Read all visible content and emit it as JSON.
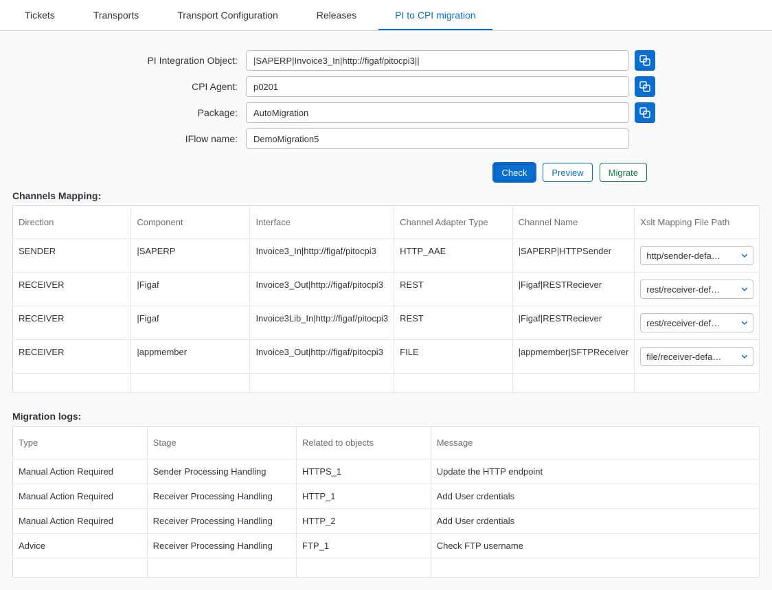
{
  "tabs": [
    "Tickets",
    "Transports",
    "Transport Configuration",
    "Releases",
    "PI to CPI migration"
  ],
  "active_tab_index": 4,
  "form": {
    "pi_object_label": "PI Integration Object:",
    "pi_object_value": "|SAPERP|Invoice3_In|http://figaf/pitocpi3||",
    "cpi_agent_label": "CPI Agent:",
    "cpi_agent_value": "p0201",
    "package_label": "Package:",
    "package_value": "AutoMigration",
    "iflow_label": "IFlow name:",
    "iflow_value": "DemoMigration5"
  },
  "buttons": {
    "check": "Check",
    "preview": "Preview",
    "migrate": "Migrate"
  },
  "channels_title": "Channels Mapping:",
  "channels_headers": {
    "direction": "Direction",
    "component": "Component",
    "interface": "Interface",
    "adapter_type": "Channel Adapter Type",
    "channel_name": "Channel Name",
    "xslt": "Xslt Mapping File Path"
  },
  "channels_rows": [
    {
      "direction": "SENDER",
      "component": "|SAPERP",
      "interface": "Invoice3_In|http://figaf/pitocpi3",
      "adapter_type": "HTTP_AAE",
      "channel_name": "|SAPERP|HTTPSender",
      "xslt": "http/sender-defa…"
    },
    {
      "direction": "RECEIVER",
      "component": "|Figaf",
      "interface": "Invoice3_Out|http://figaf/pitocpi3",
      "adapter_type": "REST",
      "channel_name": "|Figaf|RESTReciever",
      "xslt": "rest/receiver-def…"
    },
    {
      "direction": "RECEIVER",
      "component": "|Figaf",
      "interface": "Invoice3Lib_In|http://figaf/pitocpi3",
      "adapter_type": "REST",
      "channel_name": "|Figaf|RESTReciever",
      "xslt": "rest/receiver-def…"
    },
    {
      "direction": "RECEIVER",
      "component": "|appmember",
      "interface": "Invoice3_Out|http://figaf/pitocpi3",
      "adapter_type": "FILE",
      "channel_name": "|appmember|SFTPReceiver",
      "xslt": "file/receiver-defa…"
    }
  ],
  "logs_title": "Migration logs:",
  "logs_headers": {
    "type": "Type",
    "stage": "Stage",
    "related": "Related to objects",
    "message": "Message"
  },
  "logs_rows": [
    {
      "type": "Manual Action Required",
      "stage": "Sender Processing Handling",
      "related": "HTTPS_1",
      "message": "Update the HTTP endpoint"
    },
    {
      "type": "Manual Action Required",
      "stage": "Receiver Processing Handling",
      "related": "HTTP_1",
      "message": "Add User crdentials"
    },
    {
      "type": "Manual Action Required",
      "stage": "Receiver Processing Handling",
      "related": "HTTP_2",
      "message": "Add User crdentials"
    },
    {
      "type": "Advice",
      "stage": "Receiver Processing Handling",
      "related": "FTP_1",
      "message": "Check FTP username"
    }
  ]
}
